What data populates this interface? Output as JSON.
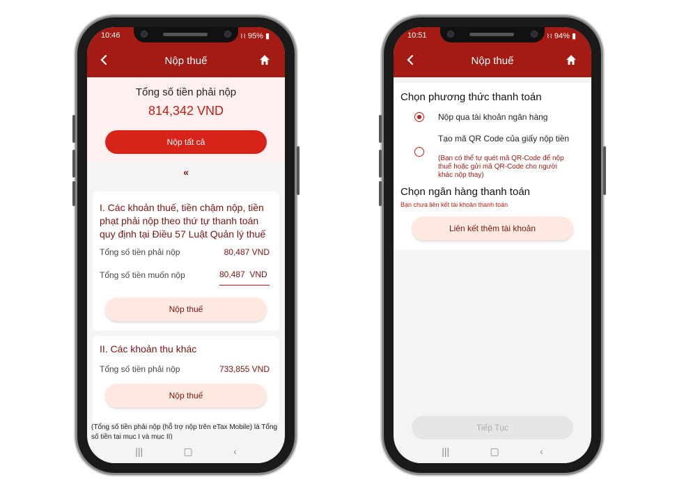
{
  "left": {
    "status": {
      "time": "10:46",
      "battery": "95%"
    },
    "appbar": {
      "title": "Nộp thuế"
    },
    "summary": {
      "label": "Tổng số tiền phải nộp",
      "amount": "814,342 VND",
      "pay_all": "Nộp tất cả"
    },
    "section1": {
      "title": "I. Các khoản thuế, tiền chậm nộp, tiền phạt phải nộp theo thứ tự thanh toán quy định tại Điều 57 Luật Quản lý thuế",
      "row1_label": "Tổng số tiền phải nộp",
      "row1_value": "80,487 VND",
      "row2_label": "Tổng số tiền muốn nộp",
      "row2_value": "80,487  VND",
      "button": "Nộp thuế"
    },
    "section2": {
      "title": "II. Các khoản thu khác",
      "row1_label": "Tổng số tiền phải nộp",
      "row1_value": "733,855 VND",
      "button": "Nộp thuế"
    },
    "footnote": "(Tổng số tiền phải nộp (hỗ trợ nộp trên eTax Mobile) là Tổng số tiền tại mục I và mục II)"
  },
  "right": {
    "status": {
      "time": "10:51",
      "battery": "94%"
    },
    "appbar": {
      "title": "Nộp thuế"
    },
    "method": {
      "heading": "Chọn phương thức thanh toán",
      "option1": "Nộp qua tài khoản ngân hàng",
      "option2_title": "Tạo mã QR Code của giấy nộp tiền",
      "option2_note": "(Bạn có thể tự quét mã QR-Code để nộp thuế hoặc gửi mã QR-Code cho người khác nộp thay)"
    },
    "bank": {
      "heading": "Chọn ngân hàng thanh toán",
      "warning": "Bạn chưa liên kết tài khoản thanh toán",
      "link_button": "Liên kết thêm tài khoản"
    },
    "continue_button": "Tiếp Tục"
  },
  "colors": {
    "primary": "#a31b12",
    "accent": "#d8231a",
    "peach": "#fde9e0"
  }
}
